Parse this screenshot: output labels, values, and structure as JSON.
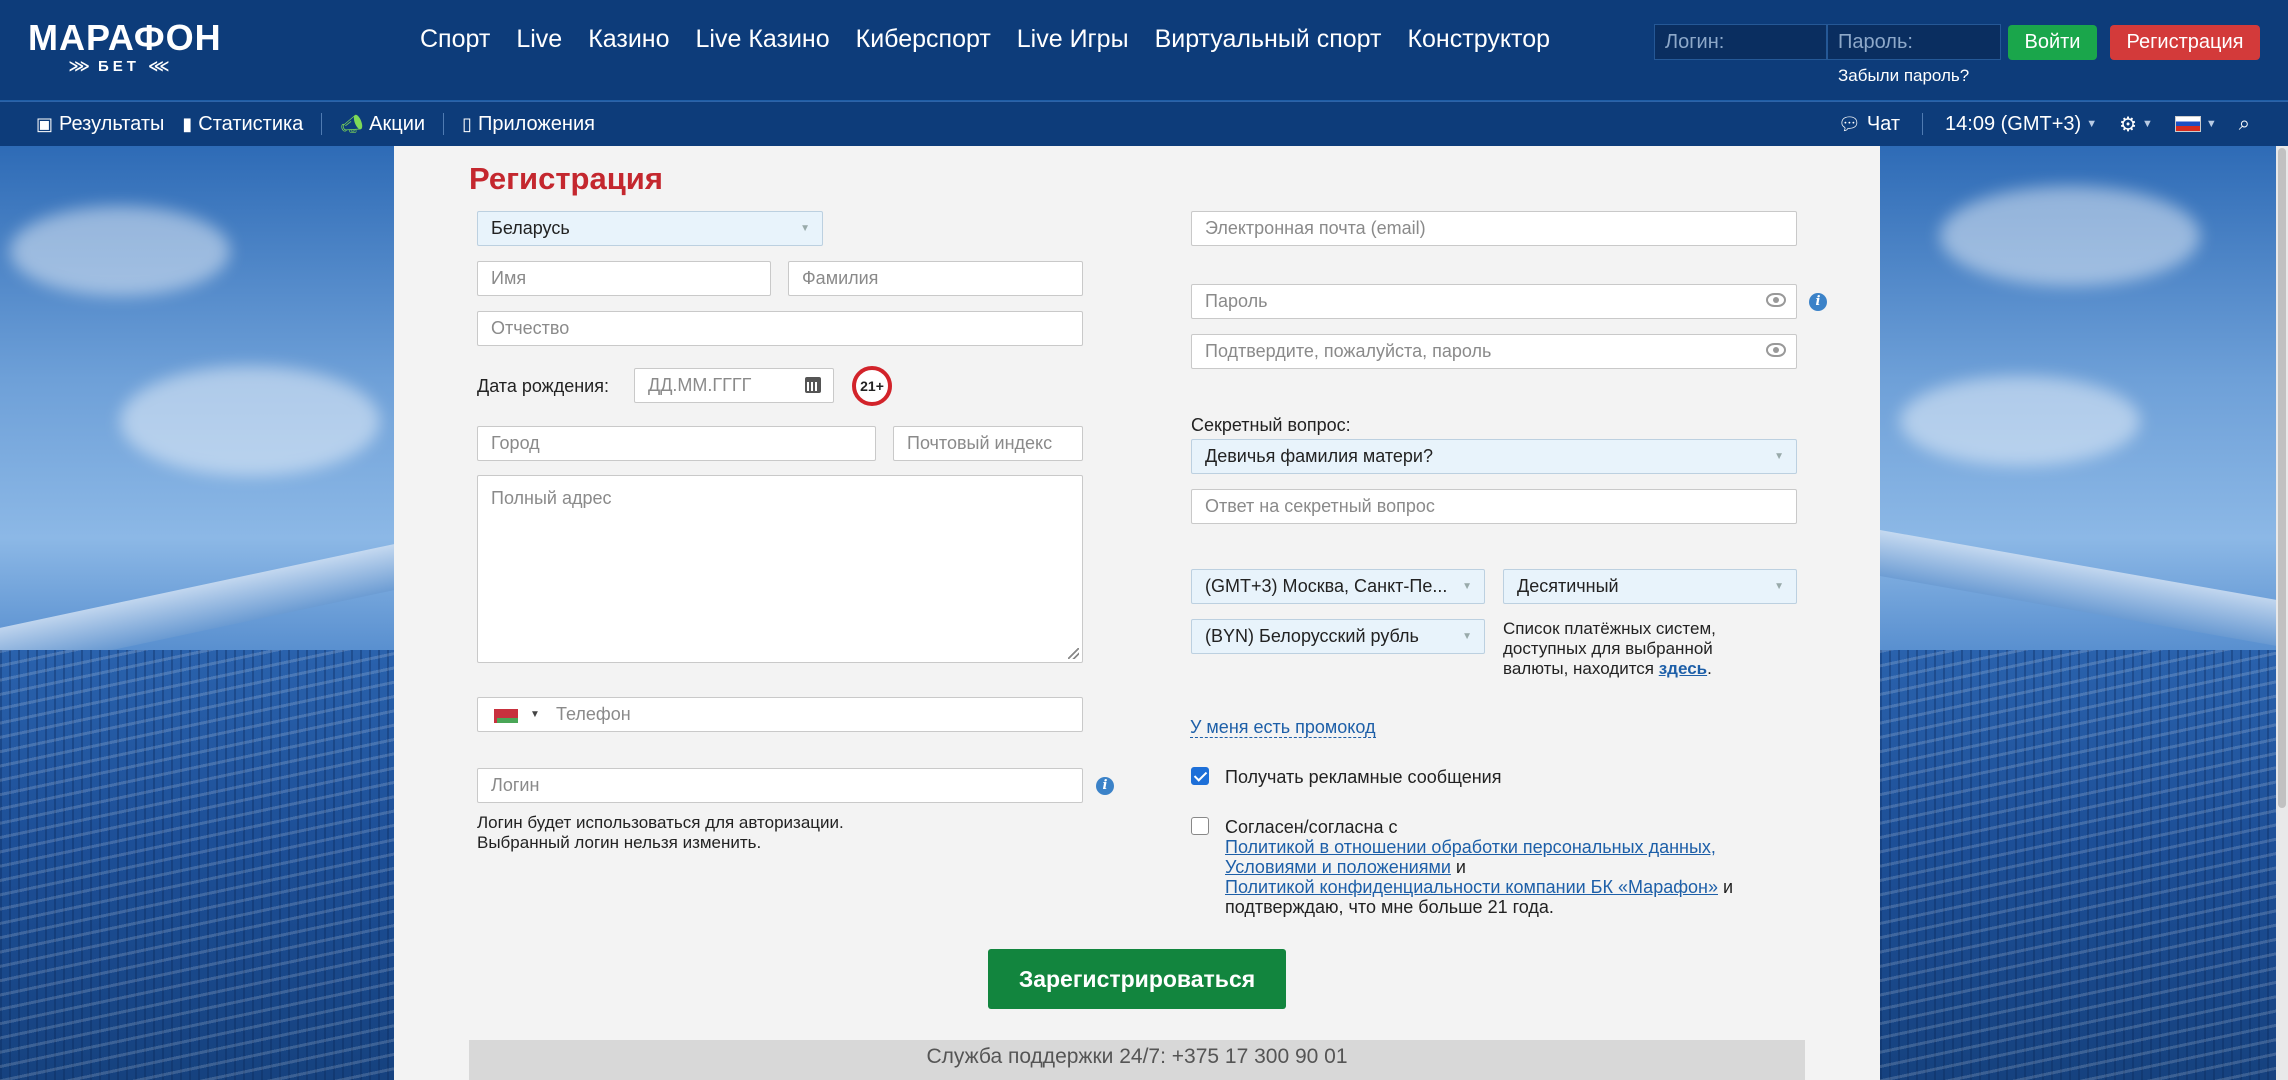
{
  "header": {
    "logo_main": "МАРАФОН",
    "logo_sub": "БЕТ",
    "nav": [
      "Спорт",
      "Live",
      "Казино",
      "Live Казино",
      "Киберспорт",
      "Live Игры",
      "Виртуальный спорт",
      "Конструктор"
    ],
    "login_placeholder": "Логин:",
    "password_placeholder": "Пароль:",
    "login_button": "Войти",
    "register_button": "Регистрация",
    "forgot_password": "Забыли пароль?"
  },
  "subnav": {
    "results": "Результаты",
    "statistics": "Статистика",
    "promotions": "Акции",
    "apps": "Приложения",
    "chat": "Чат",
    "time": "14:09 (GMT+3)"
  },
  "form": {
    "title": "Регистрация",
    "country": "Беларусь",
    "first_name_placeholder": "Имя",
    "last_name_placeholder": "Фамилия",
    "patronymic_placeholder": "Отчество",
    "birth_label": "Дата рождения:",
    "birth_placeholder": "ДД.ММ.ГГГГ",
    "age_badge": "21+",
    "city_placeholder": "Город",
    "zip_placeholder": "Почтовый индекс",
    "address_placeholder": "Полный адрес",
    "phone_placeholder": "Телефон",
    "login_placeholder": "Логин",
    "login_note_1": "Логин будет использоваться для авторизации.",
    "login_note_2": "Выбранный логин нельзя изменить.",
    "email_placeholder": "Электронная почта (email)",
    "password_placeholder": "Пароль",
    "password_confirm_placeholder": "Подтвердите, пожалуйста, пароль",
    "secret_label": "Секретный вопрос:",
    "secret_question": "Девичья фамилия матери?",
    "secret_answer_placeholder": "Ответ на секретный вопрос",
    "timezone": "(GMT+3) Москва, Санкт-Пе...",
    "odds_format": "Десятичный",
    "currency": "(BYN) Белорусский рубль",
    "payment_note_1": "Список платёжных систем,",
    "payment_note_2": "доступных для выбранной",
    "payment_note_3": "валюты, находится",
    "payment_link": "здесь",
    "payment_dot": ".",
    "promo_link": "У меня есть промокод",
    "ads_checkbox_label": "Получать рекламные сообщения",
    "ads_checked": true,
    "agree_checked": false,
    "agree_text": "Согласен/согласна с",
    "policy_link_1": "Политикой в отношении обработки персональных данных,",
    "terms_link": "Условиями и положениями",
    "and_text": " и",
    "policy_link_2": "Политикой конфиденциальности компании БК «Марафон»",
    "confirm_age_text": "подтверждаю, что мне больше 21 года.",
    "submit": "Зарегистрироваться",
    "support": "Служба поддержки 24/7: +375 17 300 90 01"
  }
}
